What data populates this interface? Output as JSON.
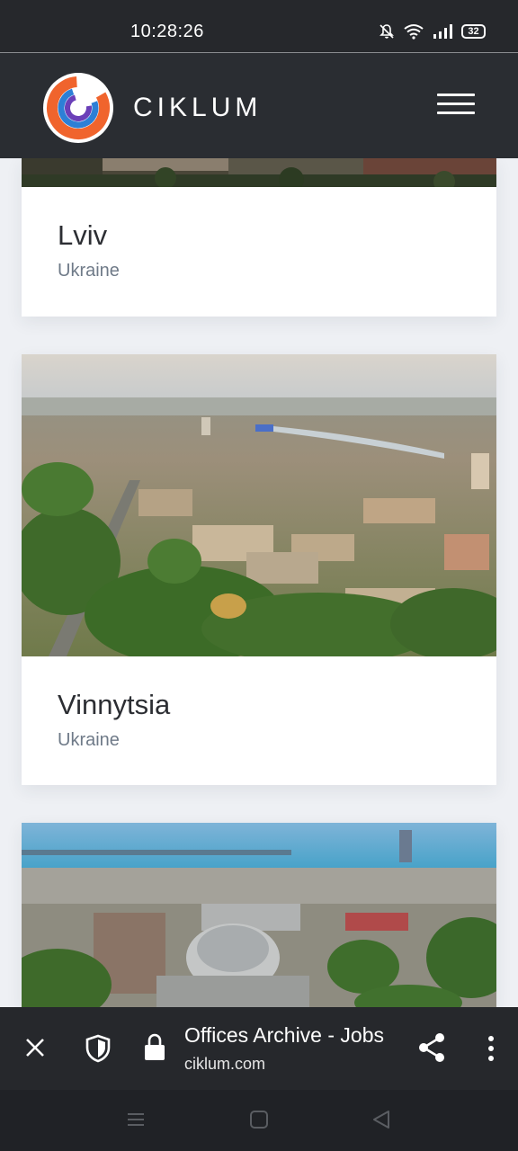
{
  "status": {
    "time": "10:28:26",
    "battery": "32"
  },
  "header": {
    "brand": "CIKLUM"
  },
  "offices": [
    {
      "city": "Lviv",
      "country": "Ukraine"
    },
    {
      "city": "Vinnytsia",
      "country": "Ukraine"
    }
  ],
  "browser": {
    "title": "Offices Archive - Jobs",
    "url": "ciklum.com"
  },
  "icons": {
    "status": [
      "mute-bell-icon",
      "wifi-icon",
      "signal-icon",
      "battery-icon"
    ],
    "browser": [
      "close-icon",
      "shield-icon",
      "lock-icon",
      "share-icon",
      "more-vert-icon"
    ],
    "nav": [
      "recents-icon",
      "home-icon",
      "back-icon"
    ]
  },
  "colors": {
    "logo_orange": "#f0642d",
    "logo_blue": "#2d7fd6",
    "logo_purple": "#6a3fb8",
    "header_bg": "#2a2d32"
  }
}
